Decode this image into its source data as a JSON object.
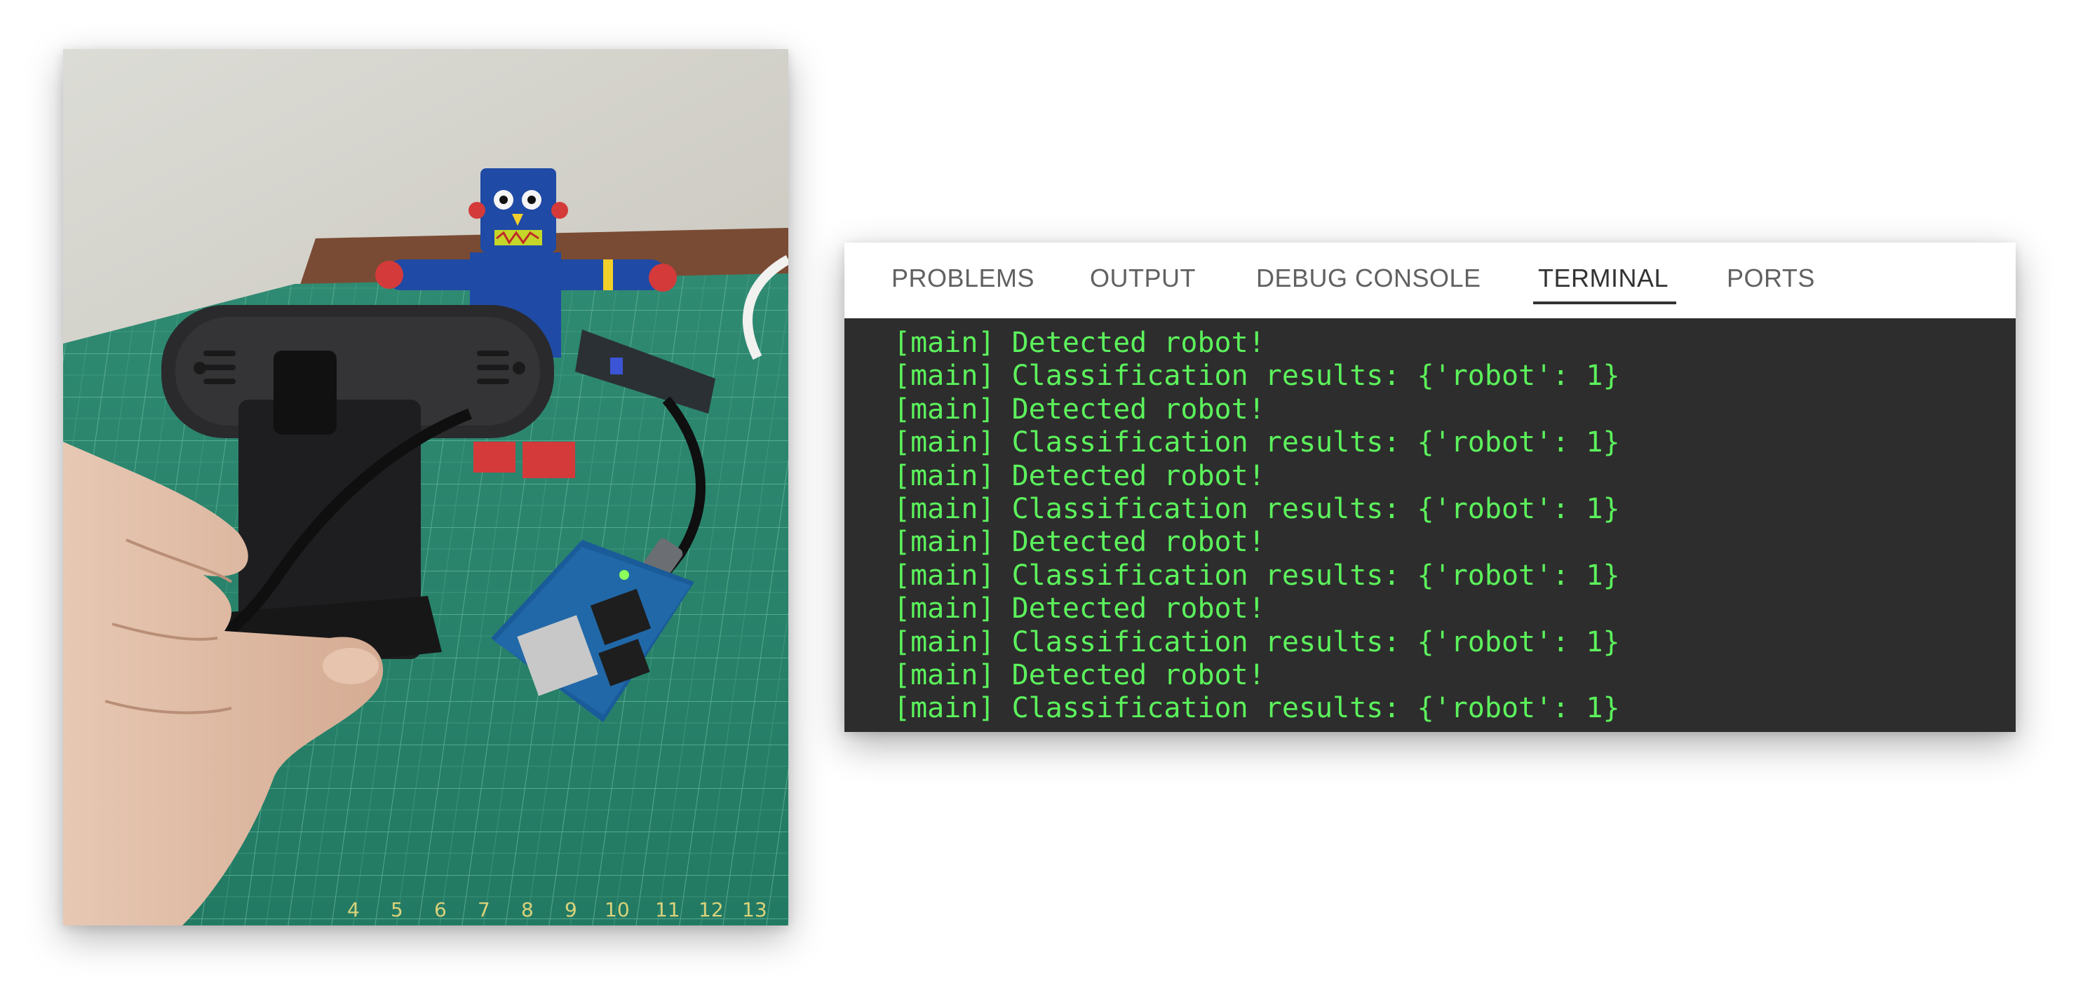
{
  "terminal": {
    "tabs": [
      {
        "label": "PROBLEMS",
        "active": false
      },
      {
        "label": "OUTPUT",
        "active": false
      },
      {
        "label": "DEBUG CONSOLE",
        "active": false
      },
      {
        "label": "TERMINAL",
        "active": true
      },
      {
        "label": "PORTS",
        "active": false
      }
    ],
    "lines": [
      "[main] Detected robot!",
      "[main] Classification results: {'robot': 1}",
      "[main] Detected robot!",
      "[main] Classification results: {'robot': 1}",
      "[main] Detected robot!",
      "[main] Classification results: {'robot': 1}",
      "[main] Detected robot!",
      "[main] Classification results: {'robot': 1}",
      "[main] Detected robot!",
      "[main] Classification results: {'robot': 1}",
      "[main] Detected robot!",
      "[main] Classification results: {'robot': 1}"
    ],
    "colors": {
      "text": "#5cf25c",
      "background": "#2d2d2d",
      "tab_active": "#333333",
      "tab_inactive": "#616161"
    }
  },
  "photo": {
    "ruler_numbers": [
      "4",
      "5",
      "6",
      "7",
      "8",
      "9",
      "10",
      "11",
      "12",
      "13"
    ]
  }
}
